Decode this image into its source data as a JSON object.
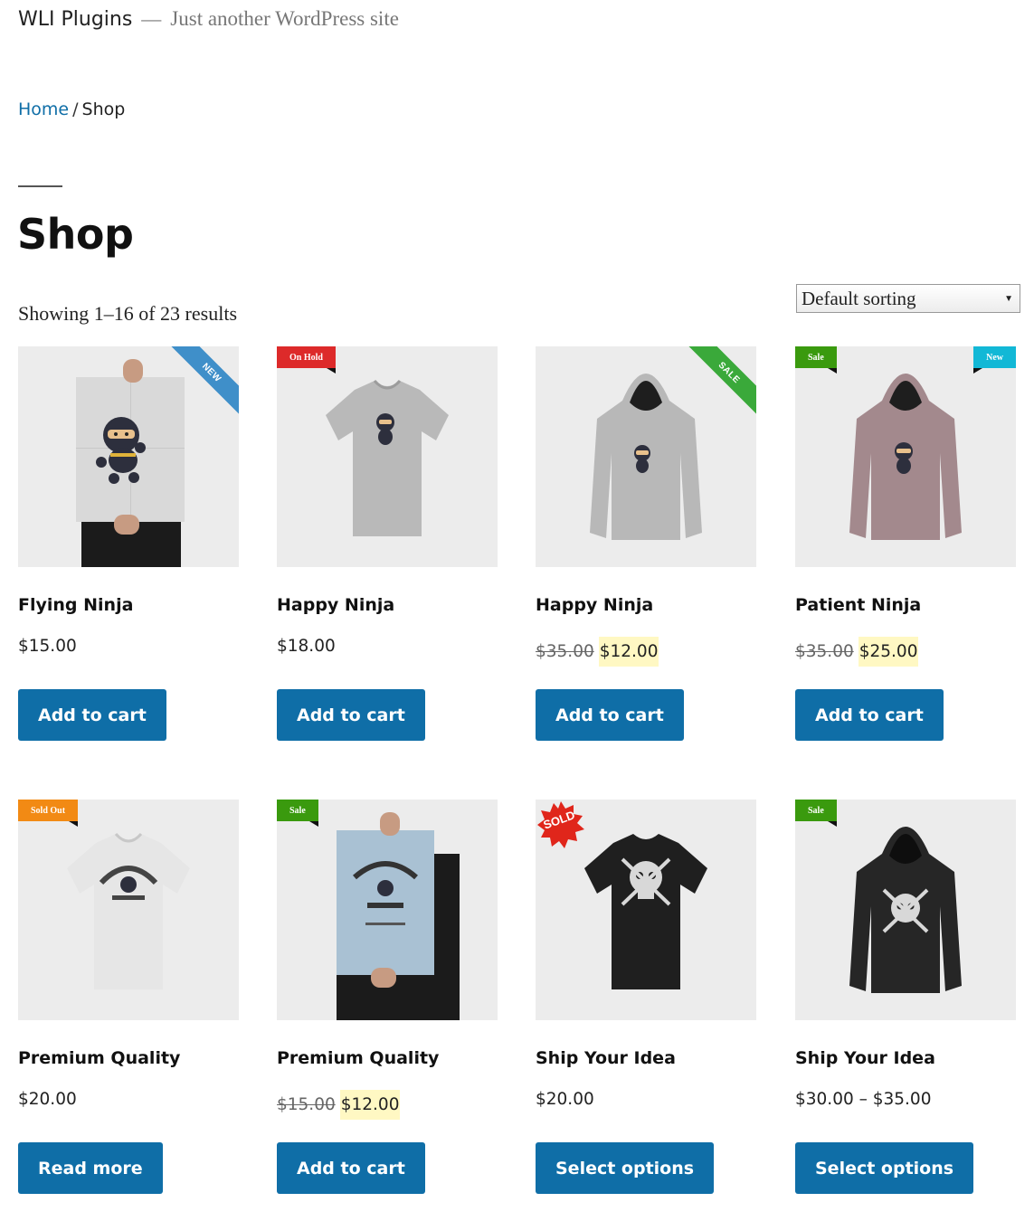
{
  "site": {
    "title": "WLI Plugins",
    "separator": "—",
    "description": "Just another WordPress site"
  },
  "breadcrumb": {
    "home": "Home",
    "separator": "/",
    "current": "Shop"
  },
  "page": {
    "title": "Shop",
    "result_count": "Showing 1–16 of 23 results",
    "ordering": "Default sorting"
  },
  "colors": {
    "button": "#0f6ea7",
    "link": "#0f6ea7",
    "sale_highlight": "#fff8c3"
  },
  "products": [
    {
      "name": "Flying Ninja",
      "price": "$15.00",
      "old_price": "",
      "new_price": "",
      "button": "Add to cart",
      "badge": "NEW",
      "badge_style": "ribbon",
      "badge_color": "#3f8fc9",
      "badge2": "",
      "image": "poster-ninja"
    },
    {
      "name": "Happy Ninja",
      "price": "$18.00",
      "old_price": "",
      "new_price": "",
      "button": "Add to cart",
      "badge": "On Hold",
      "badge_style": "flag-left",
      "badge_color": "#dd2a2a",
      "badge2": "",
      "image": "tshirt-grey"
    },
    {
      "name": "Happy Ninja",
      "price": "",
      "old_price": "$35.00",
      "new_price": "$12.00",
      "button": "Add to cart",
      "badge": "SALE",
      "badge_style": "ribbon",
      "badge_color": "#3aa93a",
      "badge2": "",
      "image": "hoodie-grey"
    },
    {
      "name": "Patient Ninja",
      "price": "",
      "old_price": "$35.00",
      "new_price": "$25.00",
      "button": "Add to cart",
      "badge": "Sale",
      "badge_style": "flag-left",
      "badge_color": "#3a9a0e",
      "badge2": "New",
      "badge2_color": "#12b8d6",
      "image": "hoodie-mauve"
    },
    {
      "name": "Premium Quality",
      "price": "$20.00",
      "old_price": "",
      "new_price": "",
      "button": "Read more",
      "badge": "Sold Out",
      "badge_style": "flag-left",
      "badge_color": "#f28a14",
      "badge2": "",
      "image": "tshirt-white"
    },
    {
      "name": "Premium Quality",
      "price": "",
      "old_price": "$15.00",
      "new_price": "$12.00",
      "button": "Add to cart",
      "badge": "Sale",
      "badge_style": "flag-left",
      "badge_color": "#3a9a0e",
      "badge2": "",
      "image": "poster-woo"
    },
    {
      "name": "Ship Your Idea",
      "price": "$20.00",
      "old_price": "",
      "new_price": "",
      "button": "Select options",
      "badge": "SOLD",
      "badge_style": "burst",
      "badge_color": "#e0261b",
      "badge2": "",
      "image": "tshirt-black"
    },
    {
      "name": "Ship Your Idea",
      "price": "$30.00 – $35.00",
      "old_price": "",
      "new_price": "",
      "button": "Select options",
      "badge": "Sale",
      "badge_style": "flag-left",
      "badge_color": "#3a9a0e",
      "badge2": "",
      "image": "hoodie-black"
    }
  ]
}
